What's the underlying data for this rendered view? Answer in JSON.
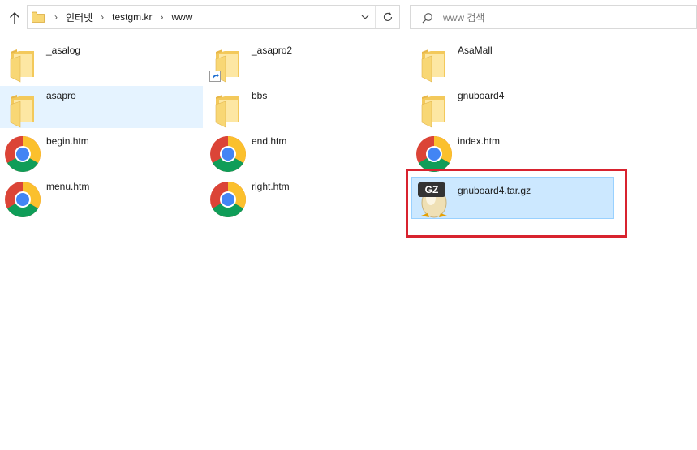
{
  "addressbar": {
    "crumbs": [
      "인터넷",
      "testgm.kr",
      "www"
    ]
  },
  "search": {
    "placeholder": "www 검색"
  },
  "files": [
    {
      "name": "_asalog",
      "type": "folder",
      "state": "normal"
    },
    {
      "name": "_asapro2",
      "type": "folder-shortcut",
      "state": "normal"
    },
    {
      "name": "AsaMall",
      "type": "folder",
      "state": "normal"
    },
    {
      "name": "asapro",
      "type": "folder",
      "state": "hover"
    },
    {
      "name": "bbs",
      "type": "folder",
      "state": "normal"
    },
    {
      "name": "gnuboard4",
      "type": "folder",
      "state": "normal"
    },
    {
      "name": "begin.htm",
      "type": "chrome-html",
      "state": "normal"
    },
    {
      "name": "end.htm",
      "type": "chrome-html",
      "state": "normal"
    },
    {
      "name": "index.htm",
      "type": "chrome-html",
      "state": "normal"
    },
    {
      "name": "menu.htm",
      "type": "chrome-html",
      "state": "normal"
    },
    {
      "name": "right.htm",
      "type": "chrome-html",
      "state": "normal"
    },
    {
      "name": "gnuboard4.tar.gz",
      "type": "gz-archive",
      "state": "selected",
      "badge": "GZ"
    }
  ],
  "colors": {
    "selection_bg": "#cce8ff",
    "hover_bg": "#e5f3ff",
    "highlight_border": "#d8232f",
    "folder_yellow": "#f8d775"
  }
}
